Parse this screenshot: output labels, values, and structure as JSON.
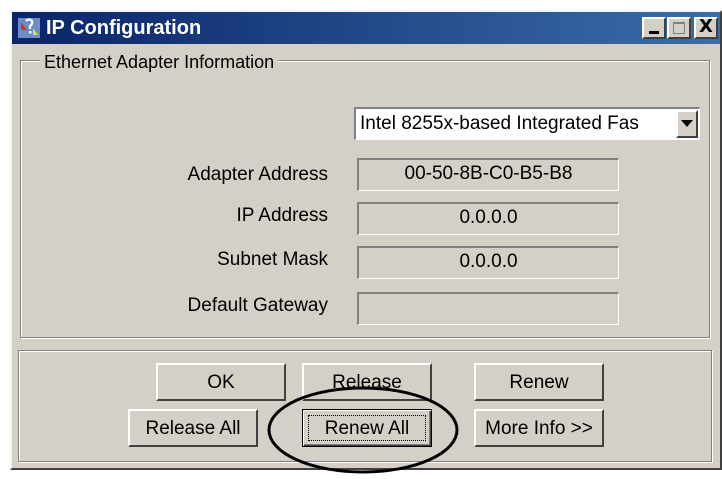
{
  "window": {
    "title": "IP Configuration",
    "controls": {
      "minimize": "",
      "maximize": "",
      "close": "X"
    }
  },
  "adapter_group": {
    "legend": "Ethernet  Adapter Information",
    "selected_adapter": "Intel 8255x-based Integrated Fas",
    "fields": [
      {
        "label": "Adapter Address",
        "value": "00-50-8B-C0-B5-B8"
      },
      {
        "label": "IP Address",
        "value": "0.0.0.0"
      },
      {
        "label": "Subnet Mask",
        "value": "0.0.0.0"
      },
      {
        "label": "Default Gateway",
        "value": ""
      }
    ]
  },
  "buttons": {
    "ok": "OK",
    "release": "Release",
    "renew": "Renew",
    "release_all": "Release All",
    "renew_all": "Renew All",
    "more_info": "More Info >>"
  },
  "annotation": {
    "highlighted_button": "Renew All",
    "color": "#000000"
  },
  "colors": {
    "face": "#d4d0c8",
    "titlebar_start": "#0a246a",
    "titlebar_end": "#3a6ea5"
  }
}
